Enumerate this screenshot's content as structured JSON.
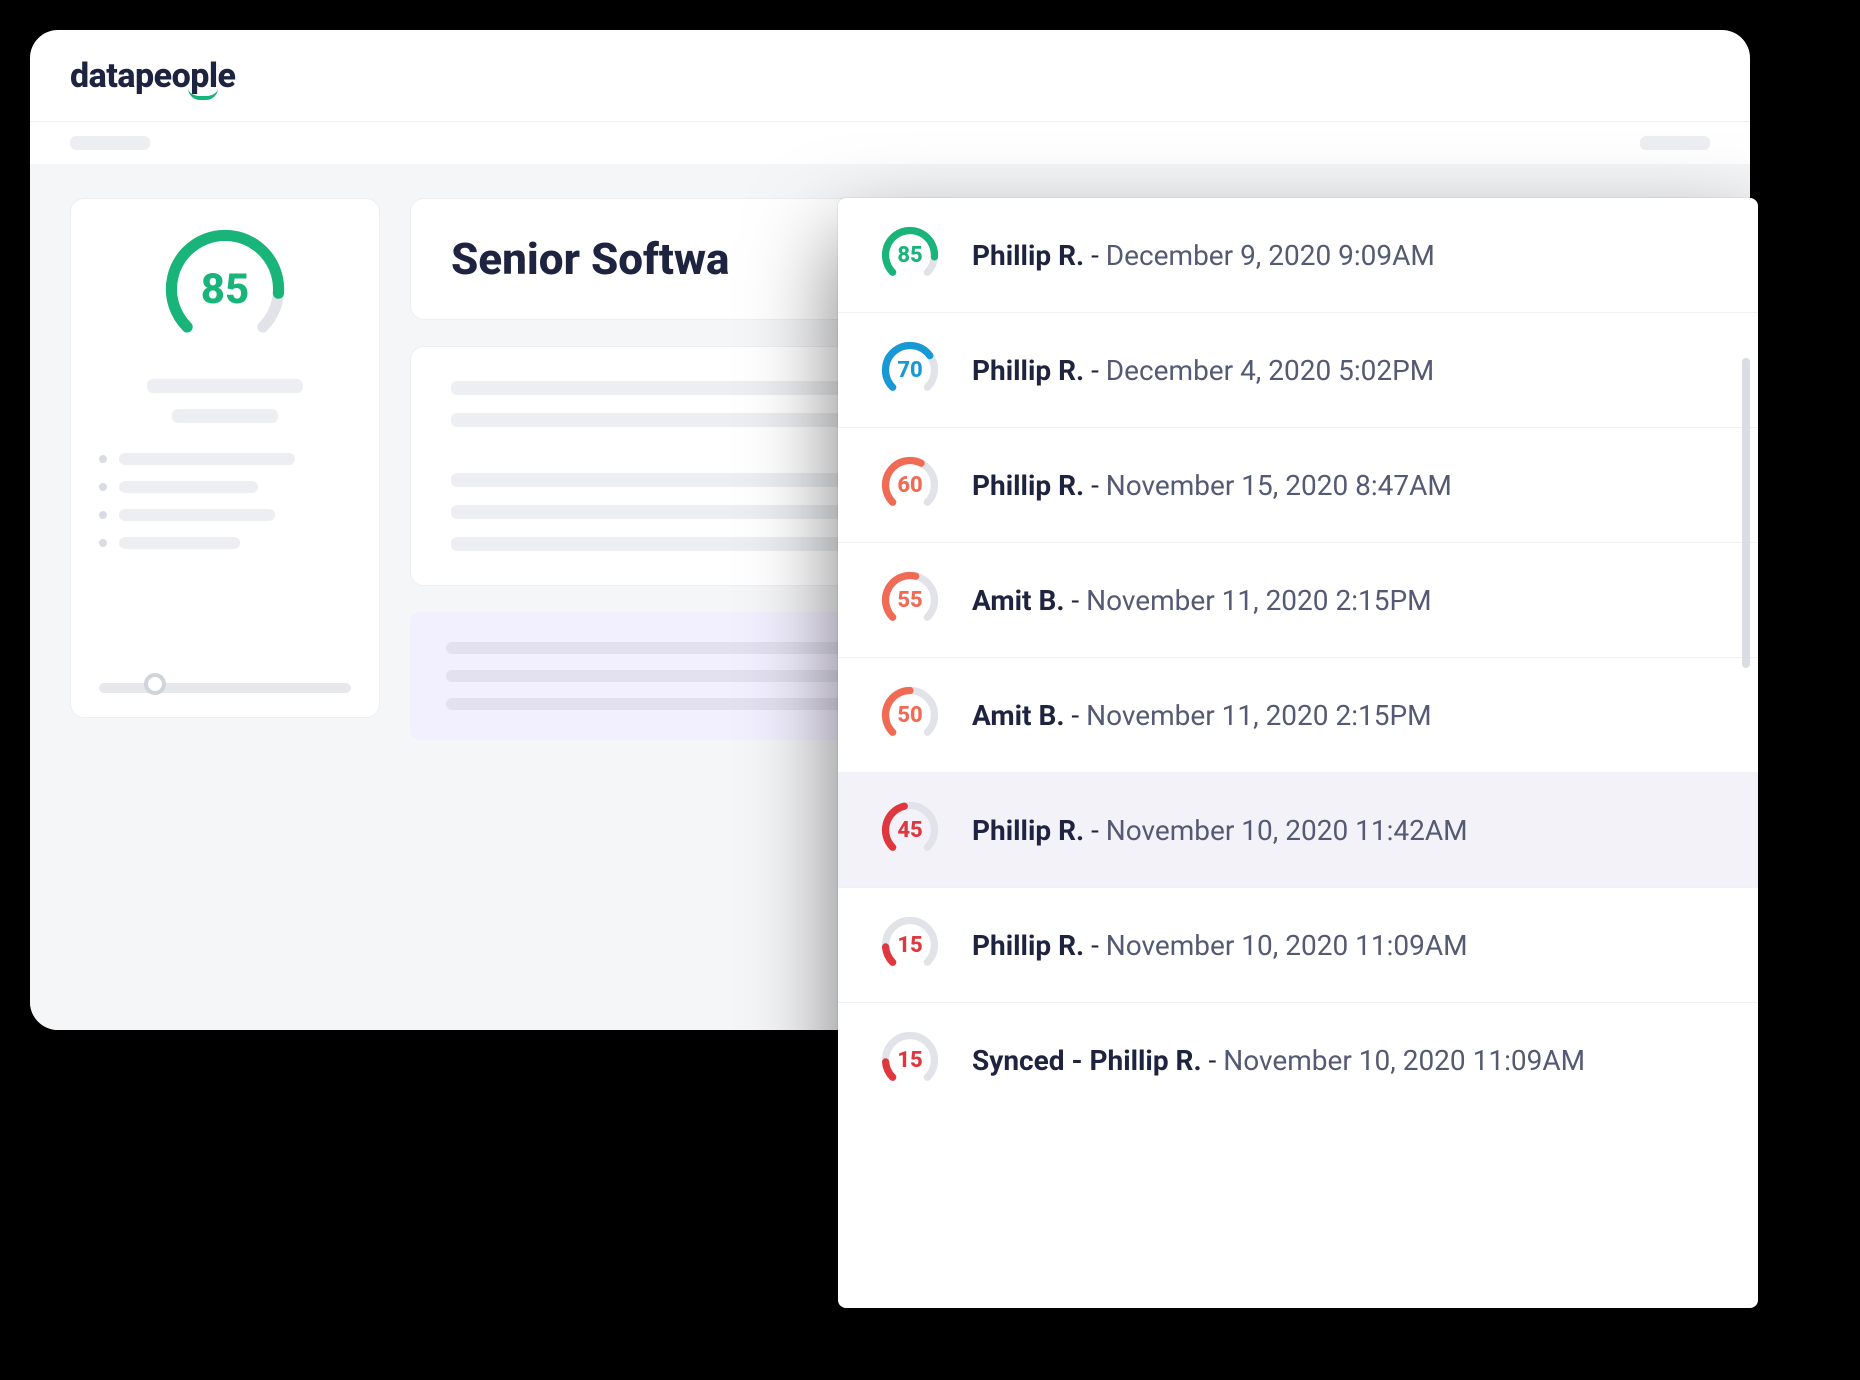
{
  "brand": {
    "name": "datapeople"
  },
  "main": {
    "score": 85,
    "title": "Senior Softwa"
  },
  "colors": {
    "green": "#19b47a",
    "blue": "#1899d6",
    "orange": "#f06a54",
    "red": "#e0373f",
    "track": "#e1e3e8"
  },
  "history": [
    {
      "score": 85,
      "color": "green",
      "author": "Phillip R.",
      "date": "December 9, 2020 9:09AM",
      "prefix": ""
    },
    {
      "score": 70,
      "color": "blue",
      "author": "Phillip R.",
      "date": "December 4, 2020 5:02PM",
      "prefix": ""
    },
    {
      "score": 60,
      "color": "orange",
      "author": "Phillip R.",
      "date": "November 15, 2020 8:47AM",
      "prefix": ""
    },
    {
      "score": 55,
      "color": "orange",
      "author": "Amit B.",
      "date": "November 11, 2020 2:15PM",
      "prefix": ""
    },
    {
      "score": 50,
      "color": "orange",
      "author": "Amit B.",
      "date": "November 11, 2020 2:15PM",
      "prefix": ""
    },
    {
      "score": 45,
      "color": "red",
      "author": "Phillip R.",
      "date": "November 10, 2020 11:42AM",
      "prefix": "",
      "selected": true
    },
    {
      "score": 15,
      "color": "red",
      "author": "Phillip R.",
      "date": "November 10, 2020 11:09AM",
      "prefix": ""
    },
    {
      "score": 15,
      "color": "red",
      "author": "Phillip R.",
      "date": "November 10, 2020 11:09AM",
      "prefix": "Synced - "
    }
  ]
}
